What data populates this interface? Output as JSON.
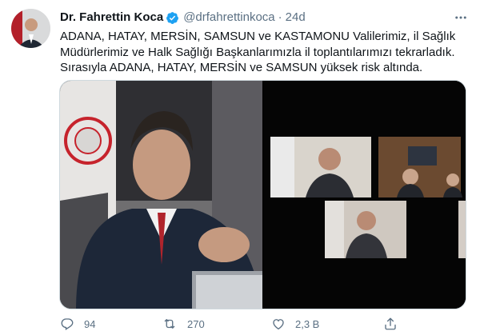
{
  "author": {
    "name": "Dr. Fahrettin Koca",
    "handle": "@drfahrettinkoca",
    "separator": "·",
    "time": "24d",
    "verified_icon": "verified-badge-icon",
    "avatar_icon": "avatar"
  },
  "tweet": {
    "lines": [
      "ADANA, HATAY, MERSİN, SAMSUN ve KASTAMONU Valilerimiz, il Sağlık",
      "Müdürlerimiz ve Halk Sağlığı Başkanlarımızla il toplantılarımızı tekrarladık.",
      "Sırasıyla ADANA, HATAY, MERSİN ve SAMSUN yüksek risk altında."
    ]
  },
  "actions": {
    "reply_count": "94",
    "retweet_count": "270",
    "like_count": "2,3 B",
    "icons": [
      "reply-icon",
      "retweet-icon",
      "like-icon",
      "share-icon"
    ]
  },
  "colors": {
    "accent": "#1da1f2",
    "muted": "#5b7083",
    "text": "#0f1419",
    "border": "#cfd9de"
  }
}
